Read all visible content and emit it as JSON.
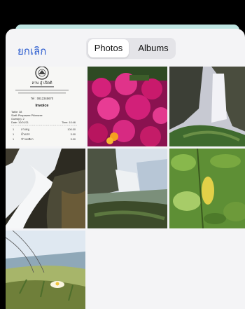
{
  "picker": {
    "cancel_label": "ยกเลิก",
    "tabs": [
      {
        "label": "Photos",
        "active": true
      },
      {
        "label": "Albums",
        "active": false
      }
    ]
  },
  "receipt": {
    "shop_name": "ลาบ อู๋ เปิดติ",
    "tel": "Tel : 0812345670",
    "title": "Invoice",
    "table_line": "Table: 38",
    "staff_line": "Staff: Pimpawee Phimsree",
    "guests_line": "Guest(s): 2",
    "date_line": "Date: 10/01/21",
    "time_line": "Time: 10:46",
    "items": [
      {
        "qty": "1",
        "name": "ลาบหมู",
        "price": "100.00"
      },
      {
        "qty": "1",
        "name": "น้ำเปล่า",
        "price": "3.00"
      },
      {
        "qty": "1",
        "name": "ข้าวเหนียว",
        "price": "3.00"
      }
    ]
  },
  "photos": [
    {
      "icon": "receipt-photo"
    },
    {
      "icon": "pink-flowers-photo"
    },
    {
      "icon": "waterfall-cliff-photo"
    },
    {
      "icon": "river-rapids-photo"
    },
    {
      "icon": "waterfall-coast-photo"
    },
    {
      "icon": "green-leaves-photo"
    },
    {
      "icon": "beach-dunes-flower-photo"
    }
  ]
}
